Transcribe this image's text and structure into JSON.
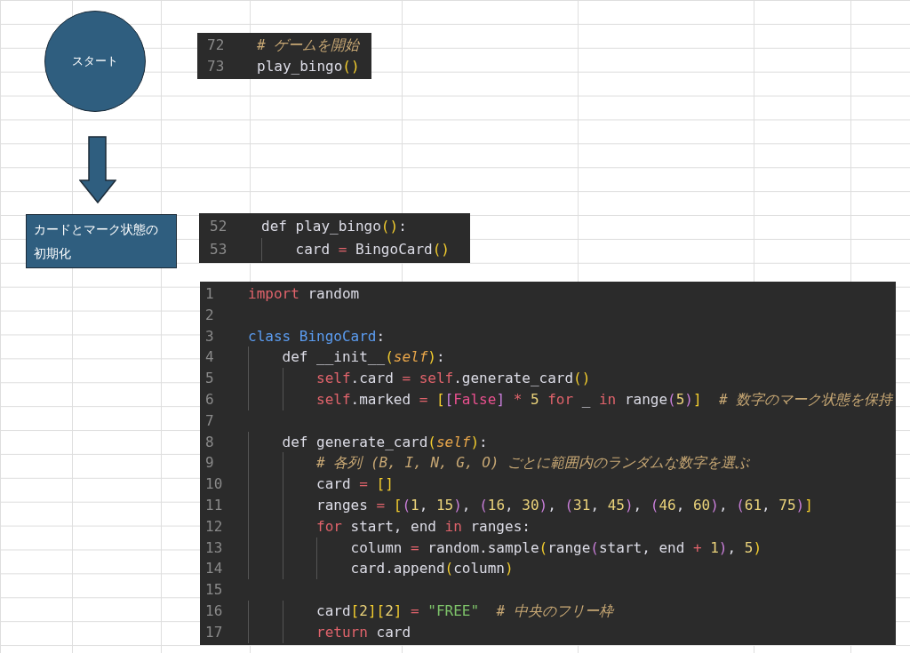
{
  "flowchart": {
    "nodes": [
      {
        "kind": "terminal",
        "label": "スタート"
      },
      {
        "kind": "arrow"
      },
      {
        "kind": "process",
        "label": "カードとマーク状態の初期化"
      }
    ]
  },
  "code_snippets": [
    {
      "lines": [
        {
          "number": "72",
          "tokens": [
            {
              "kind": "comment",
              "text": "# ゲームを開始"
            }
          ]
        },
        {
          "number": "73",
          "tokens": [
            {
              "kind": "plain",
              "text": "play_bingo"
            },
            {
              "kind": "bracket",
              "text": "()"
            }
          ]
        }
      ]
    },
    {
      "lines": [
        {
          "number": "52",
          "tokens": [
            {
              "kind": "plain",
              "text": "def play_bingo"
            },
            {
              "kind": "bracket",
              "text": "()"
            },
            {
              "kind": "plain",
              "text": ":"
            }
          ],
          "children": [
            {
              "number": "53",
              "tokens": [
                {
                  "kind": "plain",
                  "text": "card "
                },
                {
                  "kind": "op",
                  "text": "= "
                },
                {
                  "kind": "plain",
                  "text": "BingoCard"
                },
                {
                  "kind": "bracket",
                  "text": "()"
                }
              ]
            }
          ]
        }
      ]
    },
    {
      "lines": [
        {
          "number": "1",
          "tokens": [
            {
              "kind": "keyword",
              "text": "import"
            },
            {
              "kind": "plain",
              "text": " random"
            }
          ]
        },
        {
          "number": "2"
        },
        {
          "number": "3",
          "tokens": [
            {
              "kind": "class",
              "text": "class BingoCard"
            },
            {
              "kind": "plain",
              "text": ":"
            }
          ],
          "children": [
            {
              "number": "4",
              "tokens": [
                {
                  "kind": "plain",
                  "text": "def __init__"
                },
                {
                  "kind": "bracket",
                  "text": "("
                },
                {
                  "kind": "param",
                  "text": "self"
                },
                {
                  "kind": "bracket",
                  "text": ")"
                },
                {
                  "kind": "plain",
                  "text": ":"
                }
              ],
              "children": [
                {
                  "number": "5",
                  "tokens": [
                    {
                      "kind": "self",
                      "text": "self"
                    },
                    {
                      "kind": "plain",
                      "text": ".card "
                    },
                    {
                      "kind": "op",
                      "text": "= "
                    },
                    {
                      "kind": "self",
                      "text": "self"
                    },
                    {
                      "kind": "plain",
                      "text": ".generate_card"
                    },
                    {
                      "kind": "bracket",
                      "text": "()"
                    }
                  ]
                },
                {
                  "number": "6",
                  "tokens": [
                    {
                      "kind": "self",
                      "text": "self"
                    },
                    {
                      "kind": "plain",
                      "text": ".marked "
                    },
                    {
                      "kind": "op",
                      "text": "= "
                    },
                    {
                      "kind": "bracket",
                      "text": "["
                    },
                    {
                      "kind": "bracket2",
                      "text": "["
                    },
                    {
                      "kind": "bool",
                      "text": "False"
                    },
                    {
                      "kind": "bracket2",
                      "text": "] "
                    },
                    {
                      "kind": "op",
                      "text": "* "
                    },
                    {
                      "kind": "number",
                      "text": "5 "
                    },
                    {
                      "kind": "keyword",
                      "text": "for"
                    },
                    {
                      "kind": "plain",
                      "text": " _ "
                    },
                    {
                      "kind": "keyword",
                      "text": "in"
                    },
                    {
                      "kind": "plain",
                      "text": " range"
                    },
                    {
                      "kind": "bracket2",
                      "text": "("
                    },
                    {
                      "kind": "number",
                      "text": "5"
                    },
                    {
                      "kind": "bracket2",
                      "text": ")"
                    },
                    {
                      "kind": "bracket",
                      "text": "]  "
                    },
                    {
                      "kind": "comment",
                      "text": "# 数字のマーク状態を保持"
                    }
                  ]
                }
              ]
            },
            {
              "number": "7"
            },
            {
              "number": "8",
              "tokens": [
                {
                  "kind": "plain",
                  "text": "def generate_card"
                },
                {
                  "kind": "bracket",
                  "text": "("
                },
                {
                  "kind": "param",
                  "text": "self"
                },
                {
                  "kind": "bracket",
                  "text": ")"
                },
                {
                  "kind": "plain",
                  "text": ":"
                }
              ],
              "children": [
                {
                  "number": "9",
                  "tokens": [
                    {
                      "kind": "comment",
                      "text": "# 各列 (B, I, N, G, O) ごとに範囲内のランダムな数字を選ぶ"
                    }
                  ]
                },
                {
                  "number": "10",
                  "tokens": [
                    {
                      "kind": "plain",
                      "text": "card "
                    },
                    {
                      "kind": "op",
                      "text": "= "
                    },
                    {
                      "kind": "bracket",
                      "text": "[]"
                    }
                  ]
                },
                {
                  "number": "11",
                  "tokens": [
                    {
                      "kind": "plain",
                      "text": "ranges "
                    },
                    {
                      "kind": "op",
                      "text": "= "
                    },
                    {
                      "kind": "bracket",
                      "text": "["
                    },
                    {
                      "kind": "bracket2",
                      "text": "("
                    },
                    {
                      "kind": "number",
                      "text": "1"
                    },
                    {
                      "kind": "plain",
                      "text": ", "
                    },
                    {
                      "kind": "number",
                      "text": "15"
                    },
                    {
                      "kind": "bracket2",
                      "text": ")"
                    },
                    {
                      "kind": "plain",
                      "text": ", "
                    },
                    {
                      "kind": "bracket2",
                      "text": "("
                    },
                    {
                      "kind": "number",
                      "text": "16"
                    },
                    {
                      "kind": "plain",
                      "text": ", "
                    },
                    {
                      "kind": "number",
                      "text": "30"
                    },
                    {
                      "kind": "bracket2",
                      "text": ")"
                    },
                    {
                      "kind": "plain",
                      "text": ", "
                    },
                    {
                      "kind": "bracket2",
                      "text": "("
                    },
                    {
                      "kind": "number",
                      "text": "31"
                    },
                    {
                      "kind": "plain",
                      "text": ", "
                    },
                    {
                      "kind": "number",
                      "text": "45"
                    },
                    {
                      "kind": "bracket2",
                      "text": ")"
                    },
                    {
                      "kind": "plain",
                      "text": ", "
                    },
                    {
                      "kind": "bracket2",
                      "text": "("
                    },
                    {
                      "kind": "number",
                      "text": "46"
                    },
                    {
                      "kind": "plain",
                      "text": ", "
                    },
                    {
                      "kind": "number",
                      "text": "60"
                    },
                    {
                      "kind": "bracket2",
                      "text": ")"
                    },
                    {
                      "kind": "plain",
                      "text": ", "
                    },
                    {
                      "kind": "bracket2",
                      "text": "("
                    },
                    {
                      "kind": "number",
                      "text": "61"
                    },
                    {
                      "kind": "plain",
                      "text": ", "
                    },
                    {
                      "kind": "number",
                      "text": "75"
                    },
                    {
                      "kind": "bracket2",
                      "text": ")"
                    },
                    {
                      "kind": "bracket",
                      "text": "]"
                    }
                  ]
                },
                {
                  "number": "12",
                  "tokens": [
                    {
                      "kind": "keyword",
                      "text": "for"
                    },
                    {
                      "kind": "plain",
                      "text": " start, end "
                    },
                    {
                      "kind": "keyword",
                      "text": "in"
                    },
                    {
                      "kind": "plain",
                      "text": " ranges:"
                    }
                  ],
                  "children": [
                    {
                      "number": "13",
                      "tokens": [
                        {
                          "kind": "plain",
                          "text": "column "
                        },
                        {
                          "kind": "op",
                          "text": "= "
                        },
                        {
                          "kind": "plain",
                          "text": "random.sample"
                        },
                        {
                          "kind": "bracket",
                          "text": "("
                        },
                        {
                          "kind": "plain",
                          "text": "range"
                        },
                        {
                          "kind": "bracket2",
                          "text": "("
                        },
                        {
                          "kind": "plain",
                          "text": "start, end "
                        },
                        {
                          "kind": "op",
                          "text": "+ "
                        },
                        {
                          "kind": "number",
                          "text": "1"
                        },
                        {
                          "kind": "bracket2",
                          "text": ")"
                        },
                        {
                          "kind": "plain",
                          "text": ", "
                        },
                        {
                          "kind": "number",
                          "text": "5"
                        },
                        {
                          "kind": "bracket",
                          "text": ")"
                        }
                      ]
                    },
                    {
                      "number": "14",
                      "tokens": [
                        {
                          "kind": "plain",
                          "text": "card.append"
                        },
                        {
                          "kind": "bracket",
                          "text": "("
                        },
                        {
                          "kind": "plain",
                          "text": "column"
                        },
                        {
                          "kind": "bracket",
                          "text": ")"
                        }
                      ]
                    }
                  ]
                },
                {
                  "number": "15"
                },
                {
                  "number": "16",
                  "tokens": [
                    {
                      "kind": "plain",
                      "text": "card"
                    },
                    {
                      "kind": "bracket",
                      "text": "["
                    },
                    {
                      "kind": "number",
                      "text": "2"
                    },
                    {
                      "kind": "bracket",
                      "text": "]["
                    },
                    {
                      "kind": "number",
                      "text": "2"
                    },
                    {
                      "kind": "bracket",
                      "text": "] "
                    },
                    {
                      "kind": "op",
                      "text": "= "
                    },
                    {
                      "kind": "string",
                      "text": "\"FREE\"  "
                    },
                    {
                      "kind": "comment",
                      "text": "# 中央のフリー枠"
                    }
                  ]
                },
                {
                  "number": "17",
                  "tokens": [
                    {
                      "kind": "keyword",
                      "text": "return"
                    },
                    {
                      "kind": "plain",
                      "text": " card"
                    }
                  ]
                }
              ]
            }
          ]
        }
      ]
    }
  ]
}
